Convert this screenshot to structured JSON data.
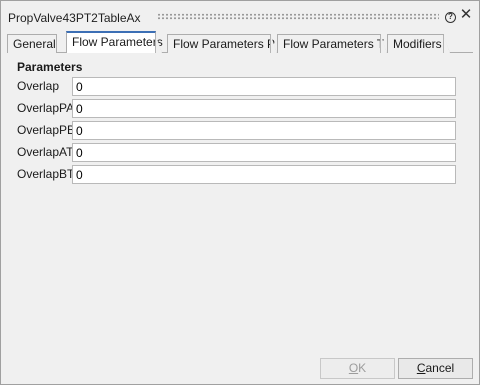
{
  "window": {
    "title": "PropValve43PT2TableAx"
  },
  "tabs": [
    {
      "label": "General"
    },
    {
      "label": "Flow Parameters"
    },
    {
      "label": "Flow Parameters P"
    },
    {
      "label": "Flow Parameters T"
    },
    {
      "label": "Modifiers"
    }
  ],
  "active_tab": "Flow Parameters",
  "section": {
    "title": "Parameters"
  },
  "fields": [
    {
      "label": "Overlap",
      "value": "0"
    },
    {
      "label": "OverlapPA",
      "value": "0"
    },
    {
      "label": "OverlapPB",
      "value": "0"
    },
    {
      "label": "OverlapAT",
      "value": "0"
    },
    {
      "label": "OverlapBT",
      "value": "0"
    }
  ],
  "buttons": {
    "ok_mnemonic": "O",
    "ok_rest": "K",
    "ok_enabled": false,
    "cancel_mnemonic": "C",
    "cancel_rest": "ancel"
  },
  "icons": {
    "help": "help-icon",
    "close": "close-icon",
    "grip": "drag-grip"
  },
  "colors": {
    "active_tab_accent": "#3c6fb5",
    "dialog_bg": "#f0f0f0"
  }
}
